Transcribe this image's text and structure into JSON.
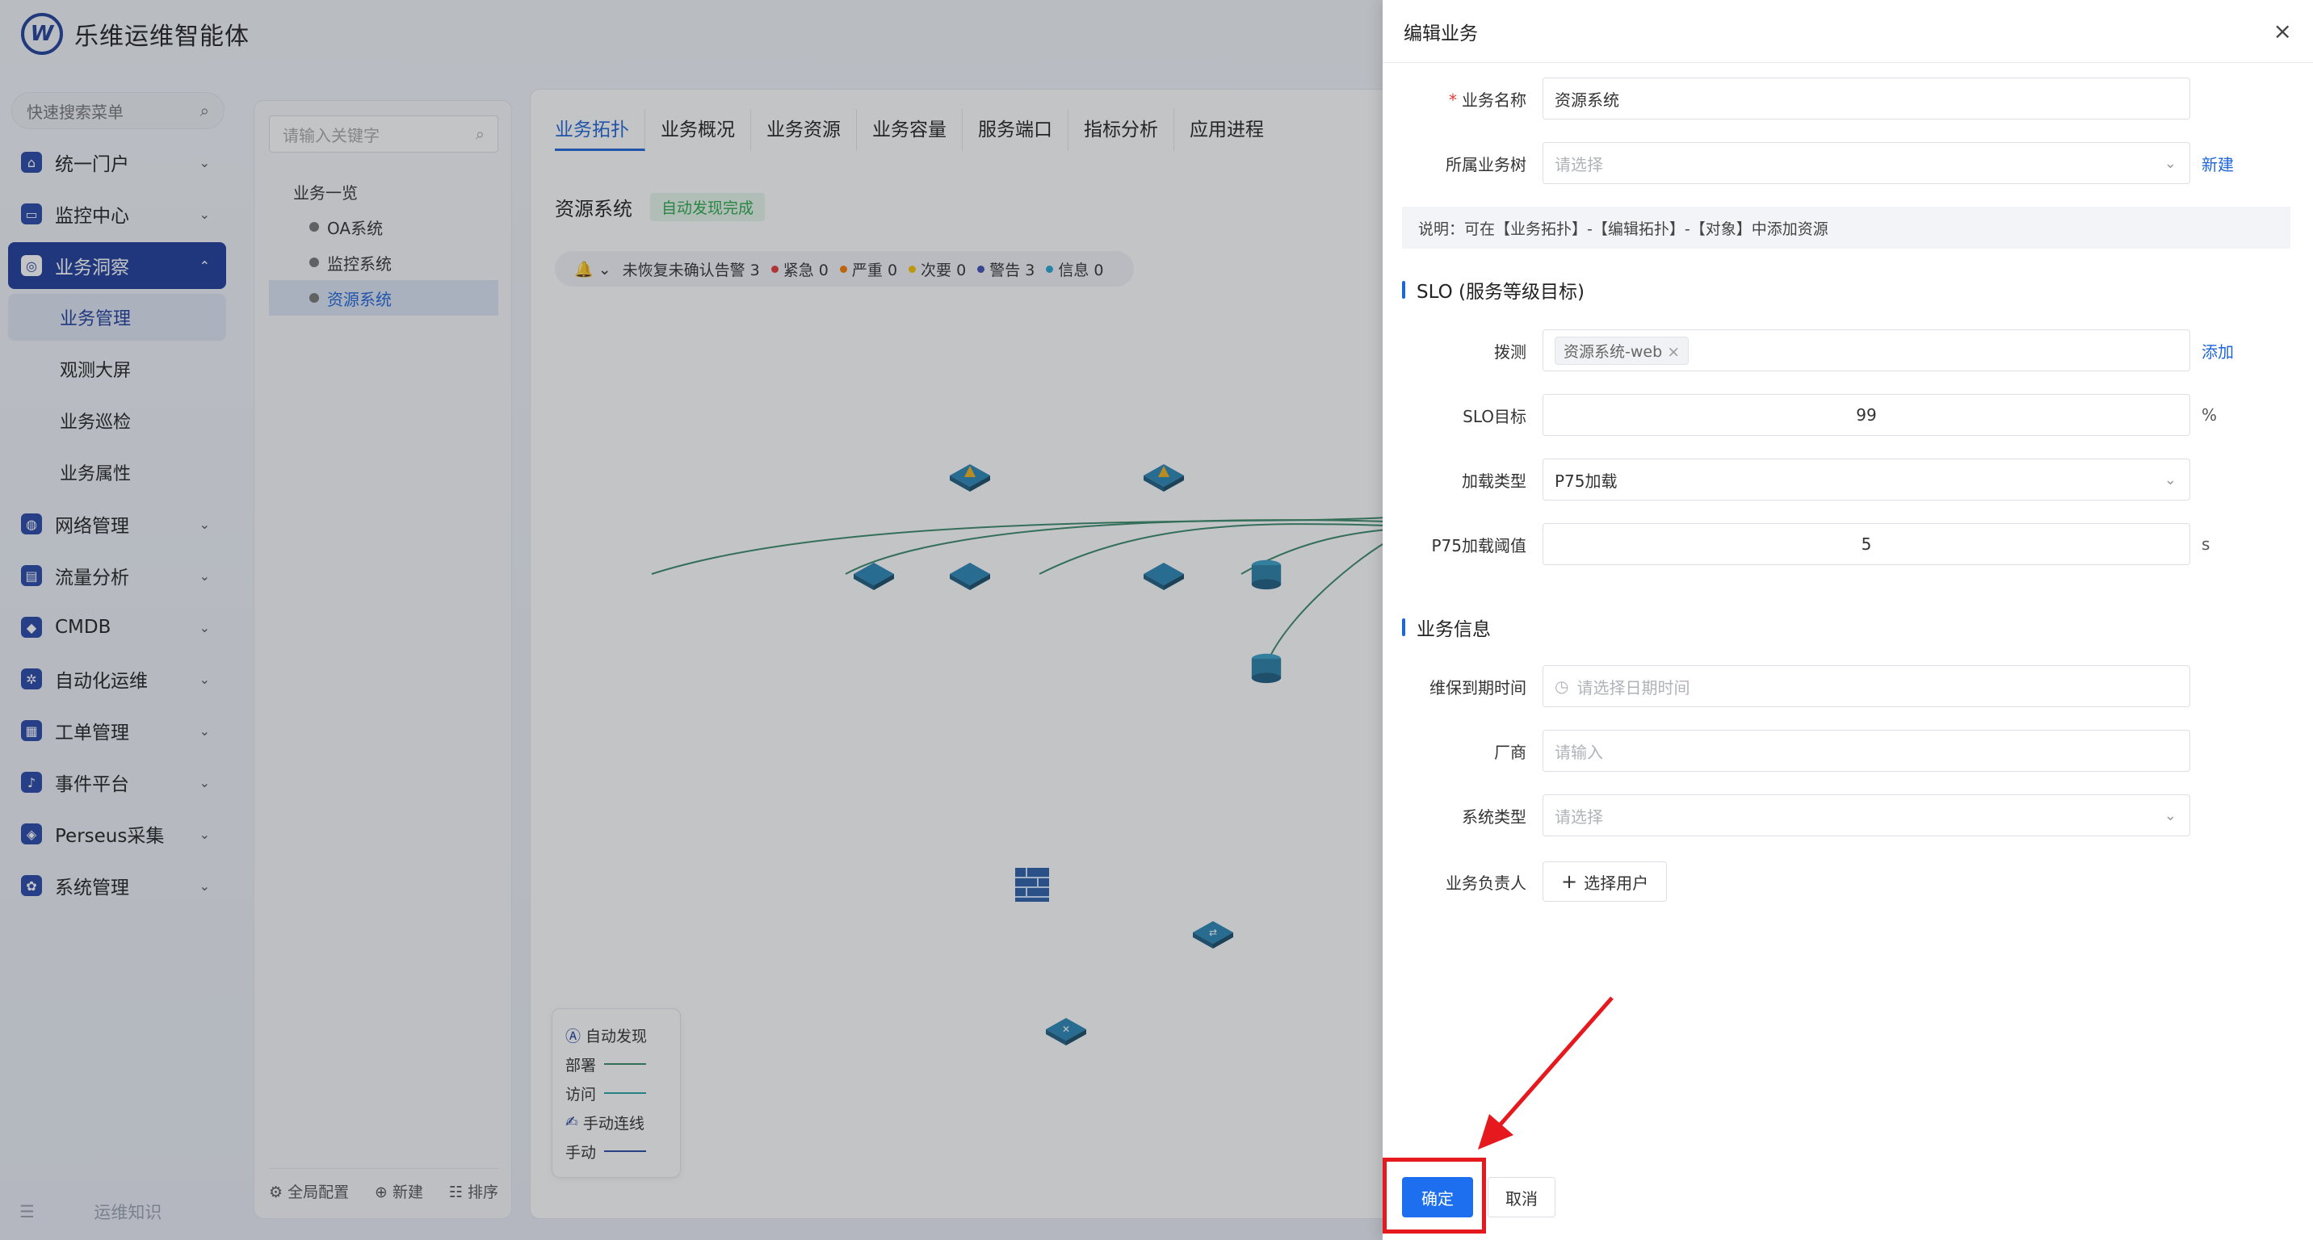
{
  "app": {
    "logo_letter": "W",
    "brand": "乐维运维智能体"
  },
  "sidebar": {
    "search_placeholder": "快速搜索菜单",
    "items": [
      {
        "label": "统一门户",
        "icon": "home-icon",
        "glyph": "⌂"
      },
      {
        "label": "监控中心",
        "icon": "monitor-icon",
        "glyph": "▭"
      },
      {
        "label": "业务洞察",
        "icon": "insight-icon",
        "glyph": "◎",
        "active": true
      },
      {
        "label": "网络管理",
        "icon": "globe-icon",
        "glyph": "◍"
      },
      {
        "label": "流量分析",
        "icon": "chart-icon",
        "glyph": "▤"
      },
      {
        "label": "CMDB",
        "icon": "cube-icon",
        "glyph": "◆"
      },
      {
        "label": "自动化运维",
        "icon": "gear-icon",
        "glyph": "✲"
      },
      {
        "label": "工单管理",
        "icon": "calendar-icon",
        "glyph": "▦"
      },
      {
        "label": "事件平台",
        "icon": "bell-icon",
        "glyph": "♪"
      },
      {
        "label": "Perseus采集",
        "icon": "diamond-icon",
        "glyph": "◈"
      },
      {
        "label": "系统管理",
        "icon": "settings-icon",
        "glyph": "✿"
      }
    ],
    "subitems": [
      "业务管理",
      "观测大屏",
      "业务巡检",
      "业务属性"
    ],
    "footer_label": "运维知识"
  },
  "tree": {
    "search_placeholder": "请输入关键字",
    "root": "业务一览",
    "items": [
      "OA系统",
      "监控系统",
      "资源系统"
    ],
    "footer": {
      "config": "全局配置",
      "new": "新建",
      "sort": "排序"
    }
  },
  "main": {
    "tabs": [
      "业务拓扑",
      "业务概况",
      "业务资源",
      "业务容量",
      "服务端口",
      "指标分析",
      "应用进程"
    ],
    "title": "资源系统",
    "badge": "自动发现完成",
    "alarms": {
      "unrecovered": "未恢复未确认告警 3",
      "urgent": "紧急 0",
      "severe": "严重 0",
      "minor": "次要 0",
      "warning": "警告 3",
      "info": "信息 0",
      "colors": {
        "urgent": "#e53935",
        "severe": "#f57c00",
        "minor": "#f5c400",
        "warning": "#3f51b5",
        "info": "#26a6d1"
      }
    },
    "legend": {
      "auto": "自动发现",
      "deploy": "部署",
      "visit": "访问",
      "manual_link": "手动连线",
      "manual": "手动"
    }
  },
  "drawer": {
    "title": "编辑业务",
    "fields": {
      "name": {
        "label": "业务名称",
        "value": "资源系统"
      },
      "tree": {
        "label": "所属业务树",
        "placeholder": "请选择",
        "action": "新建"
      },
      "note": "说明：可在【业务拓扑】-【编辑拓扑】-【对象】中添加资源",
      "slo_section": "SLO (服务等级目标)",
      "probe": {
        "label": "拨测",
        "tag": "资源系统-web",
        "action": "添加"
      },
      "slo_target": {
        "label": "SLO目标",
        "value": "99",
        "unit": "%"
      },
      "load_type": {
        "label": "加载类型",
        "value": "P75加载"
      },
      "p75_threshold": {
        "label": "P75加载阈值",
        "value": "5",
        "unit": "s"
      },
      "info_section": "业务信息",
      "expire": {
        "label": "维保到期时间",
        "placeholder": "请选择日期时间"
      },
      "vendor": {
        "label": "厂商",
        "placeholder": "请输入"
      },
      "sys_type": {
        "label": "系统类型",
        "placeholder": "请选择"
      },
      "owner": {
        "label": "业务负责人",
        "button": "选择用户"
      }
    },
    "buttons": {
      "ok": "确定",
      "cancel": "取消"
    }
  },
  "colors": {
    "accent": "#1e66d8",
    "nav_active": "#1e3c9b",
    "primary_button": "#1e6ff0",
    "annotation_red": "#e5191e"
  }
}
